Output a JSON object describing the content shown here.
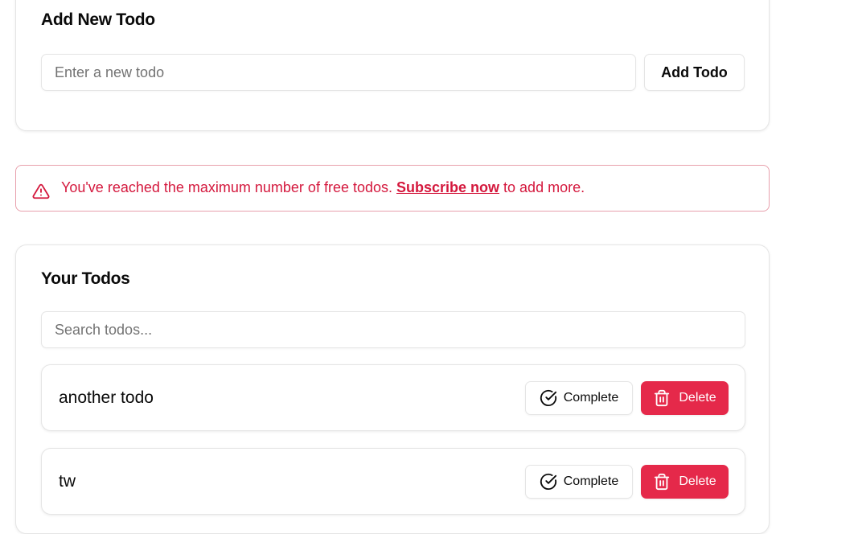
{
  "add_section": {
    "title": "Add New Todo",
    "input_placeholder": "Enter a new todo",
    "input_value": "",
    "add_button_label": "Add Todo"
  },
  "alert": {
    "text_before": "You've reached the maximum number of free todos. ",
    "link_label": "Subscribe now",
    "text_after": " to add more.",
    "icon": "alert-triangle-icon",
    "color": "#d4183d",
    "border_color": "#e8a0ac"
  },
  "todos_section": {
    "title": "Your Todos",
    "search_placeholder": "Search todos...",
    "search_value": "",
    "items": [
      {
        "text": "another todo",
        "complete_label": "Complete",
        "delete_label": "Delete"
      },
      {
        "text": "tw",
        "complete_label": "Complete",
        "delete_label": "Delete"
      }
    ]
  },
  "colors": {
    "danger": "#e5294a",
    "border": "#e5e5e5",
    "text": "#0a0a0a",
    "muted": "#737373"
  },
  "icons": {
    "complete": "check-circle-icon",
    "delete": "trash-icon"
  }
}
